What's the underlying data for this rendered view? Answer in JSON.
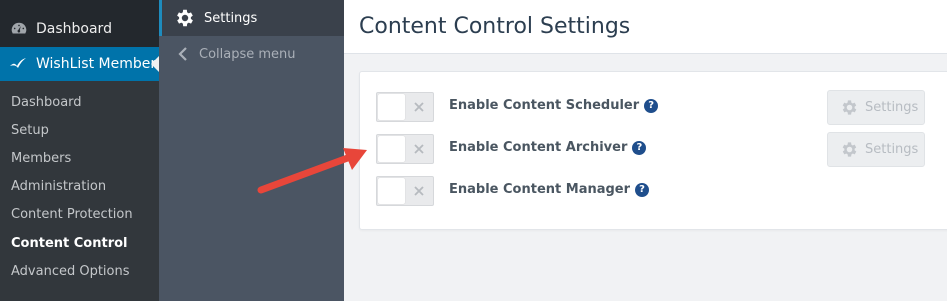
{
  "admin_menu": {
    "dashboard_label": "Dashboard",
    "wishlist_label": "WishList Member",
    "submenu": [
      {
        "label": "Dashboard"
      },
      {
        "label": "Setup"
      },
      {
        "label": "Members"
      },
      {
        "label": "Administration"
      },
      {
        "label": "Content Protection"
      },
      {
        "label": "Content Control"
      },
      {
        "label": "Advanced Options"
      }
    ]
  },
  "wl_panel": {
    "settings_label": "Settings",
    "collapse_label": "Collapse menu"
  },
  "page": {
    "title": "Content Control Settings"
  },
  "settings_rows": [
    {
      "label": "Enable Content Scheduler",
      "help": "?",
      "button_label": "Settings",
      "enabled": false
    },
    {
      "label": "Enable Content Archiver",
      "help": "?",
      "button_label": "Settings",
      "enabled": false
    },
    {
      "label": "Enable Content Manager",
      "help": "?",
      "enabled": false
    }
  ],
  "colors": {
    "admin_bg": "#23282d",
    "accent": "#0073aa",
    "arrow": "#e8463a",
    "help": "#1f4e8c"
  }
}
